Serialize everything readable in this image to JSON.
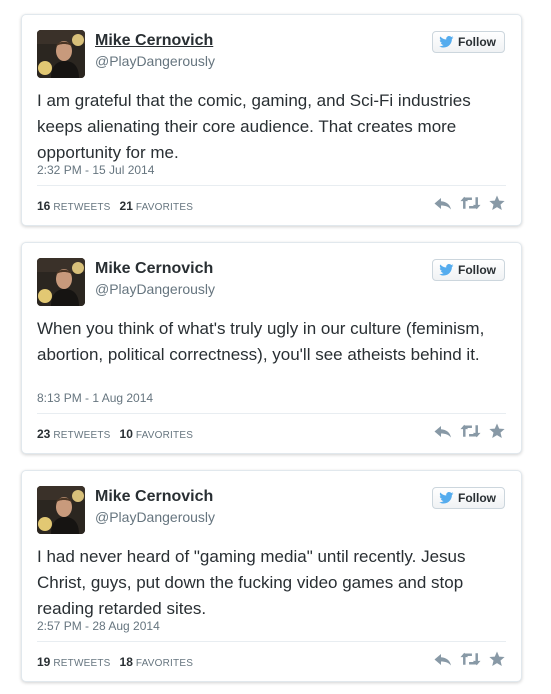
{
  "colors": {
    "text": "#292f33",
    "secondary": "#66757f",
    "twitter_blue": "#55acee",
    "action_icon": "#8899a6"
  },
  "follow_icon": "twitter-bird-icon",
  "tweets": [
    {
      "name": "Mike Cernovich",
      "handle": "@PlayDangerously",
      "follow_label": "Follow",
      "text": "I am grateful that the comic, gaming, and Sci-Fi industries keeps alienating their core audience. That creates more opportunity for me.",
      "timestamp": "2:32 PM - 15 Jul 2014",
      "retweets": "16",
      "retweets_label": "RETWEETS",
      "favorites": "21",
      "favorites_label": "FAVORITES"
    },
    {
      "name": "Mike Cernovich",
      "handle": "@PlayDangerously",
      "follow_label": "Follow",
      "text": "When you think of what's truly ugly in our culture (feminism, abortion, political correctness), you'll see atheists behind it.",
      "timestamp": "8:13 PM - 1 Aug 2014",
      "retweets": "23",
      "retweets_label": "RETWEETS",
      "favorites": "10",
      "favorites_label": "FAVORITES"
    },
    {
      "name": "Mike Cernovich",
      "handle": "@PlayDangerously",
      "follow_label": "Follow",
      "text": "I had never heard of \"gaming media\" until recently. Jesus Christ, guys, put down the fucking video games and stop reading retarded sites.",
      "timestamp": "2:57 PM - 28 Aug 2014",
      "retweets": "19",
      "retweets_label": "RETWEETS",
      "favorites": "18",
      "favorites_label": "FAVORITES"
    }
  ]
}
